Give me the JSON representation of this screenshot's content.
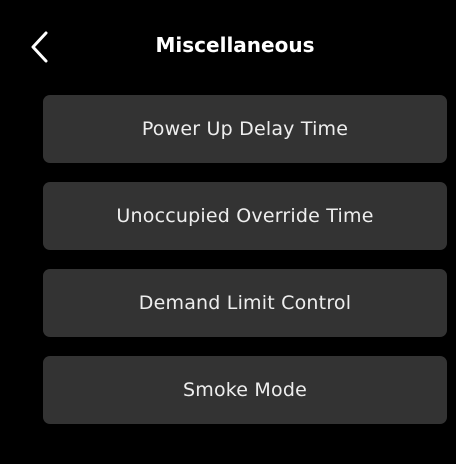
{
  "header": {
    "title": "Miscellaneous",
    "back_icon": "chevron-left-icon"
  },
  "menu": {
    "items": [
      {
        "label": "Power Up Delay Time"
      },
      {
        "label": "Unoccupied Override Time"
      },
      {
        "label": "Demand Limit Control"
      },
      {
        "label": "Smoke Mode"
      }
    ]
  },
  "colors": {
    "background": "#000000",
    "button_background": "#333333",
    "text": "#eeeeee"
  }
}
